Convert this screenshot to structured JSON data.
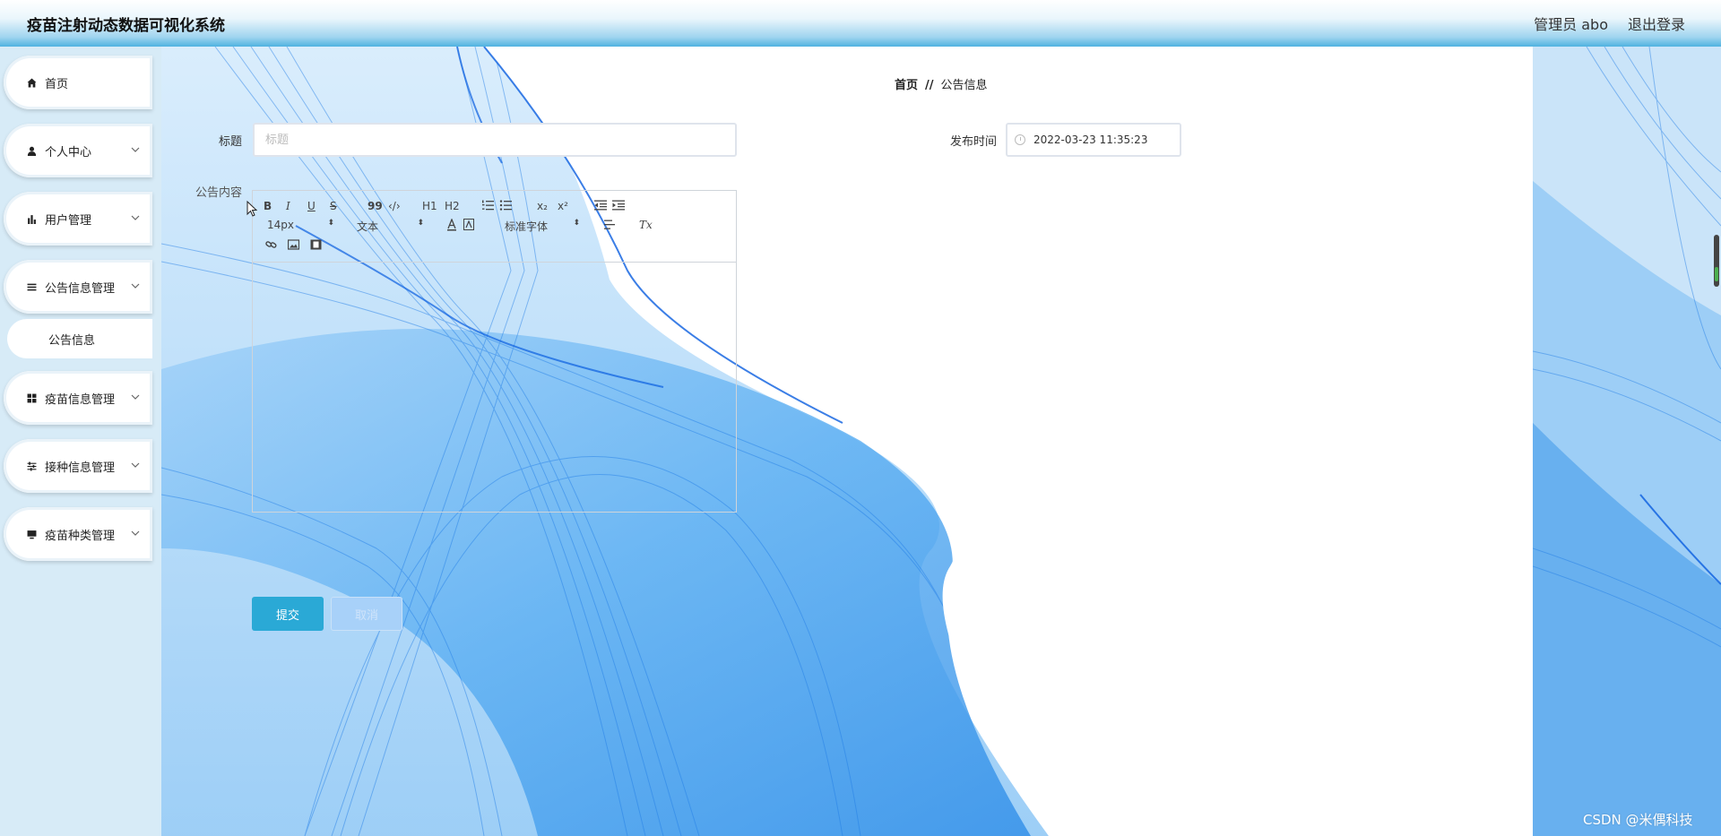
{
  "header": {
    "app_title": "疫苗注射动态数据可视化系统",
    "user_label": "管理员 abo",
    "logout_label": "退出登录"
  },
  "sidebar": {
    "items": [
      {
        "label": "首页",
        "icon": "home-icon"
      },
      {
        "label": "个人中心",
        "icon": "user-icon"
      },
      {
        "label": "用户管理",
        "icon": "bar-chart-icon"
      },
      {
        "label": "公告信息管理",
        "icon": "list-icon"
      },
      {
        "label": "疫苗信息管理",
        "icon": "grid-icon"
      },
      {
        "label": "接种信息管理",
        "icon": "sliders-icon"
      },
      {
        "label": "疫苗种类管理",
        "icon": "monitor-icon"
      }
    ],
    "sub_item": {
      "label": "公告信息"
    }
  },
  "breadcrumb": {
    "home": "首页",
    "separator": "//",
    "current": "公告信息"
  },
  "form": {
    "title_label": "标题",
    "title_placeholder": "标题",
    "title_value": "",
    "publish_time_label": "发布时间",
    "publish_time_value": "2022-03-23 11:35:23",
    "content_label": "公告内容",
    "editor": {
      "bold": "B",
      "italic": "I",
      "underline": "U",
      "strike": "S",
      "blockquote": "99",
      "code": "‹/›",
      "h1": "H1",
      "h2": "H2",
      "subscript": "x₂",
      "superscript": "x²",
      "font_size": "14px",
      "text_type": "文本",
      "font_family": "标准字体",
      "clean": "Tx"
    },
    "submit_label": "提交",
    "reset_label": "取消"
  },
  "watermark": "CSDN @米偶科技",
  "colors": {
    "accent": "#2aa9d6",
    "wave_blue": "#1e7be6",
    "sidebar_bg": "#d7ebf7"
  }
}
